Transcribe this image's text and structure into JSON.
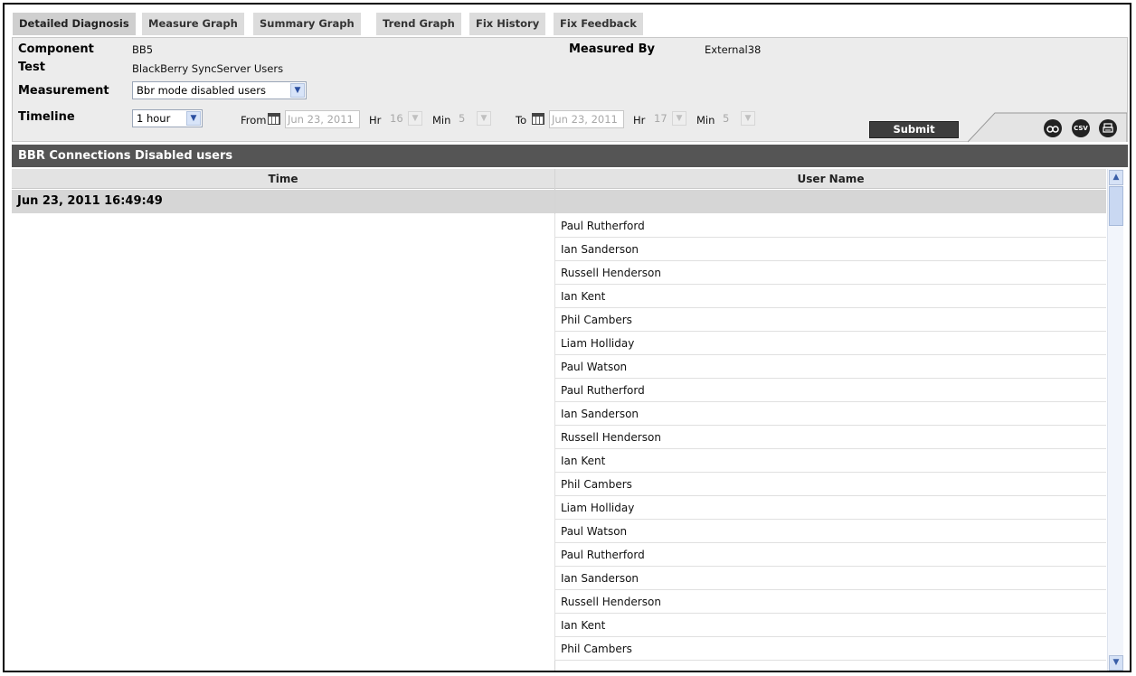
{
  "tabs": [
    {
      "label": "Detailed Diagnosis",
      "active": true
    },
    {
      "label": "Measure Graph"
    },
    {
      "label": "Summary Graph"
    },
    {
      "label": "Trend Graph"
    },
    {
      "label": "Fix History"
    },
    {
      "label": "Fix Feedback"
    }
  ],
  "info": {
    "component_label": "Component",
    "component_value": "BB5",
    "test_label": "Test",
    "test_value": "BlackBerry SyncServer Users",
    "measurement_label": "Measurement",
    "measurement_value": "Bbr mode disabled users",
    "measured_by_label": "Measured By",
    "measured_by_value": "External38",
    "timeline_label": "Timeline",
    "timeline_value": "1 hour"
  },
  "from": {
    "label": "From",
    "date_placeholder": "Jun 23, 2011",
    "hr_label": "Hr",
    "hr_value": "16",
    "min_label": "Min",
    "min_value": "5"
  },
  "to": {
    "label": "To",
    "date_placeholder": "Jun 23, 2011",
    "hr_label": "Hr",
    "hr_value": "17",
    "min_label": "Min",
    "min_value": "5"
  },
  "submit_label": "Submit",
  "tools": {
    "csv_label": "CSV"
  },
  "table": {
    "title": "BBR Connections Disabled users",
    "columns": [
      "Time",
      "User Name"
    ],
    "group_time": "Jun 23, 2011 16:49:49",
    "rows": [
      "Paul Rutherford",
      "Ian Sanderson",
      "Russell Henderson",
      "Ian Kent",
      "Phil Cambers",
      "Liam Holliday",
      "Paul Watson",
      "Paul Rutherford",
      "Ian Sanderson",
      "Russell Henderson",
      "Ian Kent",
      "Phil Cambers",
      "Liam Holliday",
      "Paul Watson",
      "Paul Rutherford",
      "Ian Sanderson",
      "Russell Henderson",
      "Ian Kent",
      "Phil Cambers"
    ]
  },
  "colors": {
    "title_bar": "#555555",
    "panel_bg": "#ececec",
    "tab_bg": "#dcdcdc",
    "submit_bg": "#3d3d3d"
  }
}
